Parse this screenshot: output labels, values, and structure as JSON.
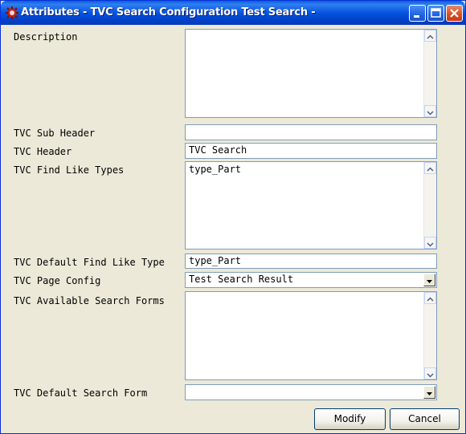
{
  "window": {
    "title": "Attributes - TVC Search Configuration Test Search -",
    "controls": [
      "minimize",
      "maximize",
      "close"
    ]
  },
  "form": {
    "description": {
      "label": "Description",
      "value": ""
    },
    "sub_header": {
      "label": "TVC Sub Header",
      "value": ""
    },
    "header": {
      "label": "TVC Header",
      "value": "TVC Search"
    },
    "find_like_types": {
      "label": "TVC Find Like Types",
      "value": "type_Part"
    },
    "default_find_like_type": {
      "label": "TVC Default Find Like Type",
      "value": "type_Part"
    },
    "page_config": {
      "label": "TVC Page Config",
      "value": "Test Search Result"
    },
    "available_search_forms": {
      "label": "TVC Available Search Forms",
      "value": ""
    },
    "default_search_form": {
      "label": "TVC Default Search Form",
      "value": ""
    }
  },
  "buttons": {
    "modify": "Modify",
    "cancel": "Cancel"
  }
}
